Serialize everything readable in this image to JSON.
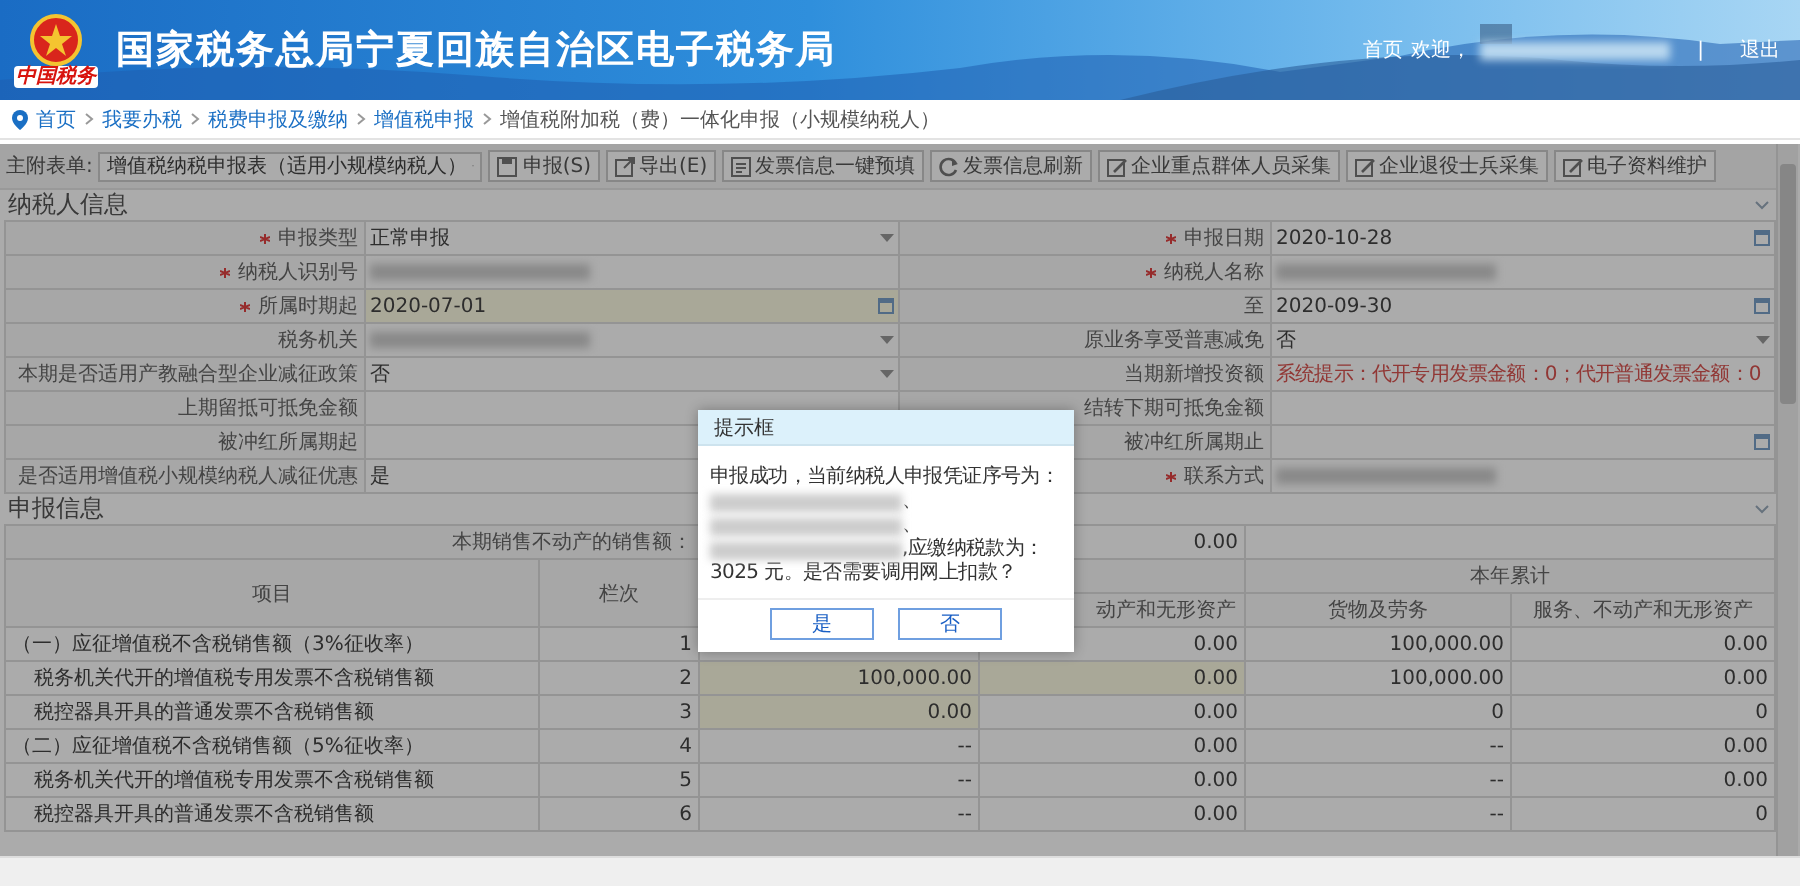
{
  "header": {
    "logo_text": "中国税务",
    "title": "国家税务总局宁夏回族自治区电子税务局",
    "links": {
      "home": "首页",
      "welcome": "欢迎，",
      "divider": "|",
      "logout": "退出"
    }
  },
  "breadcrumb": [
    {
      "label": "首页",
      "current": false
    },
    {
      "label": "我要办税",
      "current": false
    },
    {
      "label": "税费申报及缴纳",
      "current": false
    },
    {
      "label": "增值税申报",
      "current": false
    },
    {
      "label": "增值税附加税（费）一体化申报（小规模纳税人）",
      "current": true
    }
  ],
  "toolbar": {
    "form_label": "主附表单:",
    "form_select": "增值税纳税申报表（适用小规模纳税人）",
    "buttons": [
      "申报(S)",
      "导出(E)",
      "发票信息一键预填",
      "发票信息刷新",
      "企业重点群体人员采集",
      "企业退役士兵采集",
      "电子资料维护"
    ]
  },
  "taxpayer_info": {
    "title": "纳税人信息",
    "rows": [
      [
        {
          "label": "申报类型",
          "required": true,
          "kind": "select",
          "value": "正常申报",
          "highlighted": false
        },
        {
          "label": "申报日期",
          "required": true,
          "kind": "date",
          "value": "2020-10-28",
          "highlighted": false
        }
      ],
      [
        {
          "label": "纳税人识别号",
          "required": true,
          "kind": "text",
          "redacted": true,
          "highlighted": false
        },
        {
          "label": "纳税人名称",
          "required": true,
          "kind": "text",
          "redacted": true,
          "highlighted": false
        }
      ],
      [
        {
          "label": "所属时期起",
          "required": true,
          "kind": "date",
          "value": "2020-07-01",
          "highlighted": true
        },
        {
          "label": "至",
          "required": false,
          "kind": "date",
          "value": "2020-09-30",
          "highlighted": false
        }
      ],
      [
        {
          "label": "税务机关",
          "required": false,
          "kind": "select",
          "redacted": true,
          "highlighted": false
        },
        {
          "label": "原业务享受普惠减免",
          "required": false,
          "kind": "select",
          "value": "否",
          "highlighted": false
        }
      ],
      [
        {
          "label": "本期是否适用产教融合型企业减征政策",
          "required": false,
          "kind": "select",
          "value": "否",
          "highlighted": false
        },
        {
          "label": "当期新增投资额",
          "required": false,
          "kind": "text",
          "hint": "系统提示：代开专用发票金额：0；代开普通发票金额：0",
          "highlighted": false
        }
      ],
      [
        {
          "label": "上期留抵可抵免金额",
          "required": false,
          "kind": "text",
          "highlighted": false
        },
        {
          "label": "结转下期可抵免金额",
          "required": false,
          "kind": "text",
          "highlighted": false
        }
      ],
      [
        {
          "label": "被冲红所属期起",
          "required": false,
          "kind": "text",
          "highlighted": false
        },
        {
          "label": "被冲红所属期止",
          "required": false,
          "kind": "date",
          "highlighted": false
        }
      ],
      [
        {
          "label": "是否适用增值税小规模纳税人减征优惠",
          "required": false,
          "kind": "text",
          "value": "是",
          "highlighted": false
        },
        {
          "label": "联系方式",
          "required": true,
          "kind": "text",
          "redacted": true,
          "highlighted": false
        }
      ]
    ]
  },
  "declaration": {
    "title": "申报信息",
    "property_sale": {
      "label": "本期销售不动产的销售额：",
      "value": "0.00"
    },
    "headers": {
      "item": "项目",
      "line": "栏次",
      "year_total": "本年累计",
      "sub": [
        "动产和无形资产",
        "货物及劳务",
        "服务、不动产和无形资产"
      ]
    },
    "rows": [
      {
        "kind": "group",
        "item": "（一）应征增值税不含税销售额（3%征收率）",
        "line": "1",
        "cells": [
          {
            "text": ""
          },
          {
            "text": "0.00",
            "editable": false
          },
          {
            "text": "100,000.00",
            "editable": false
          },
          {
            "text": "0.00",
            "editable": false
          }
        ]
      },
      {
        "kind": "item",
        "item": "税务机关代开的增值税专用发票不含税销售额",
        "line": "2",
        "cells": [
          {
            "text": "100,000.00",
            "editable": true
          },
          {
            "text": "0.00",
            "editable": true
          },
          {
            "text": "100,000.00",
            "editable": false
          },
          {
            "text": "0.00",
            "editable": false
          }
        ]
      },
      {
        "kind": "item",
        "item": "税控器具开具的普通发票不含税销售额",
        "line": "3",
        "cells": [
          {
            "text": "0.00",
            "editable": true
          },
          {
            "text": "0.00",
            "editable": false
          },
          {
            "text": "0",
            "editable": false
          },
          {
            "text": "0",
            "editable": false
          }
        ]
      },
      {
        "kind": "group",
        "item": "（二）应征增值税不含税销售额（5%征收率）",
        "line": "4",
        "cells": [
          {
            "text": "--",
            "editable": false
          },
          {
            "text": "0.00",
            "editable": false
          },
          {
            "text": "--",
            "editable": false
          },
          {
            "text": "0.00",
            "editable": false
          }
        ]
      },
      {
        "kind": "item",
        "item": "税务机关代开的增值税专用发票不含税销售额",
        "line": "5",
        "cells": [
          {
            "text": "--",
            "editable": false
          },
          {
            "text": "0.00",
            "editable": false
          },
          {
            "text": "--",
            "editable": false
          },
          {
            "text": "0.00",
            "editable": false
          }
        ]
      },
      {
        "kind": "item",
        "item": "税控器具开具的普通发票不含税销售额",
        "line": "6",
        "cells": [
          {
            "text": "--",
            "editable": false
          },
          {
            "text": "0.00",
            "editable": false
          },
          {
            "text": "--",
            "editable": false
          },
          {
            "text": "0",
            "editable": false
          }
        ]
      }
    ]
  },
  "dialog": {
    "title": "提示框",
    "intro": "申报成功，当前纳税人申报凭证序号为：",
    "separators": [
      "、",
      "、"
    ],
    "amount_prefix": ",应缴纳税款为：",
    "closing": "3025 元。是否需要调用网上扣款？",
    "buttons": [
      "是",
      "否"
    ]
  }
}
